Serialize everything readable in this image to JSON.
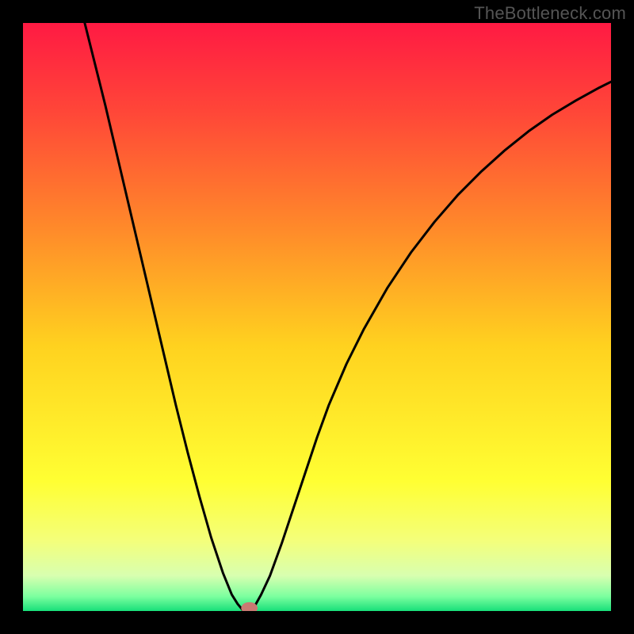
{
  "watermark": "TheBottleneck.com",
  "chart_data": {
    "type": "line",
    "title": "",
    "xlabel": "",
    "ylabel": "",
    "x_range": [
      0,
      1
    ],
    "y_range": [
      0,
      1
    ],
    "grid": false,
    "legend": false,
    "background_gradient": {
      "stops": [
        {
          "offset": 0.0,
          "color": "#ff1a43"
        },
        {
          "offset": 0.15,
          "color": "#ff4638"
        },
        {
          "offset": 0.35,
          "color": "#ff8a2a"
        },
        {
          "offset": 0.55,
          "color": "#ffd21f"
        },
        {
          "offset": 0.78,
          "color": "#ffff33"
        },
        {
          "offset": 0.88,
          "color": "#f4ff7a"
        },
        {
          "offset": 0.94,
          "color": "#d8ffb0"
        },
        {
          "offset": 0.975,
          "color": "#7dff9f"
        },
        {
          "offset": 1.0,
          "color": "#18e07a"
        }
      ]
    },
    "series": [
      {
        "name": "curve",
        "stroke": "#000000",
        "stroke_width": 3,
        "x": [
          0.105,
          0.12,
          0.14,
          0.16,
          0.18,
          0.2,
          0.22,
          0.24,
          0.26,
          0.28,
          0.3,
          0.32,
          0.34,
          0.355,
          0.365,
          0.375,
          0.385,
          0.395,
          0.405,
          0.42,
          0.44,
          0.46,
          0.48,
          0.5,
          0.52,
          0.55,
          0.58,
          0.62,
          0.66,
          0.7,
          0.74,
          0.78,
          0.82,
          0.86,
          0.9,
          0.94,
          0.98,
          1.0
        ],
        "y": [
          1.0,
          0.94,
          0.86,
          0.775,
          0.69,
          0.605,
          0.52,
          0.435,
          0.35,
          0.27,
          0.195,
          0.125,
          0.065,
          0.028,
          0.012,
          0.0,
          0.0,
          0.01,
          0.028,
          0.06,
          0.115,
          0.175,
          0.235,
          0.295,
          0.35,
          0.42,
          0.48,
          0.55,
          0.61,
          0.662,
          0.708,
          0.748,
          0.784,
          0.816,
          0.844,
          0.868,
          0.89,
          0.9
        ]
      }
    ],
    "marker": {
      "name": "bottleneck-point",
      "x": 0.385,
      "y": 0.005,
      "rx": 0.014,
      "ry": 0.01,
      "fill": "#c97a72"
    }
  }
}
